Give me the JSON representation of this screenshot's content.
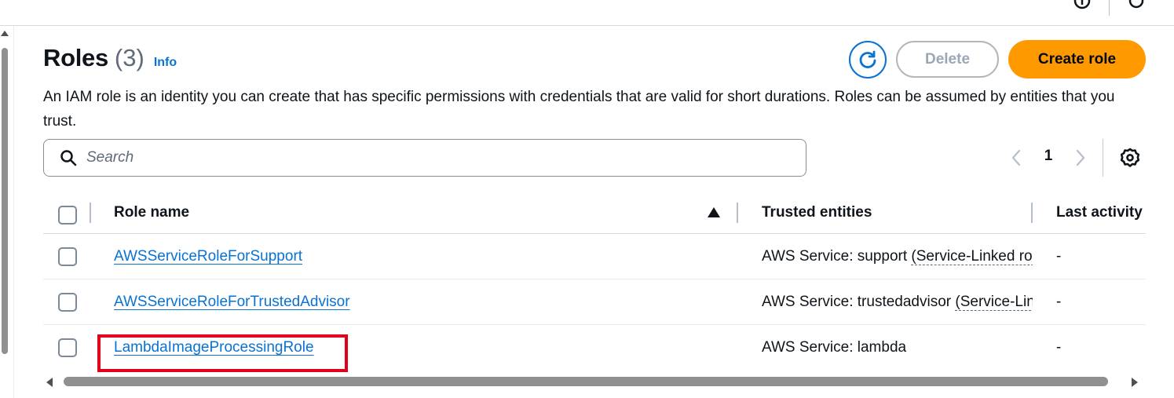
{
  "header": {
    "title": "Roles",
    "count": "(3)",
    "info_label": "Info",
    "description": "An IAM role is an identity you can create that has specific permissions with credentials that are valid for short durations. Roles can be assumed by entities that you trust."
  },
  "actions": {
    "refresh_icon": "refresh-icon",
    "delete_label": "Delete",
    "create_label": "Create role"
  },
  "search": {
    "placeholder": "Search"
  },
  "pagination": {
    "current_page": "1"
  },
  "table": {
    "columns": [
      "Role name",
      "Trusted entities",
      "Last activity"
    ],
    "rows": [
      {
        "role_name": "AWSServiceRoleForSupport",
        "trusted_prefix": "AWS Service: support",
        "trusted_suffix": "(Service-Linked role)",
        "last_activity": "-"
      },
      {
        "role_name": "AWSServiceRoleForTrustedAdvisor",
        "trusted_prefix": "AWS Service: trustedadvisor",
        "trusted_suffix": "(Service-Linked role)",
        "last_activity": "-"
      },
      {
        "role_name": "LambdaImageProcessingRole",
        "trusted_prefix": "AWS Service: lambda",
        "trusted_suffix": "",
        "last_activity": "-"
      }
    ]
  },
  "colors": {
    "primary": "#ff9900",
    "link": "#0972d3",
    "highlight": "#e0001b"
  }
}
